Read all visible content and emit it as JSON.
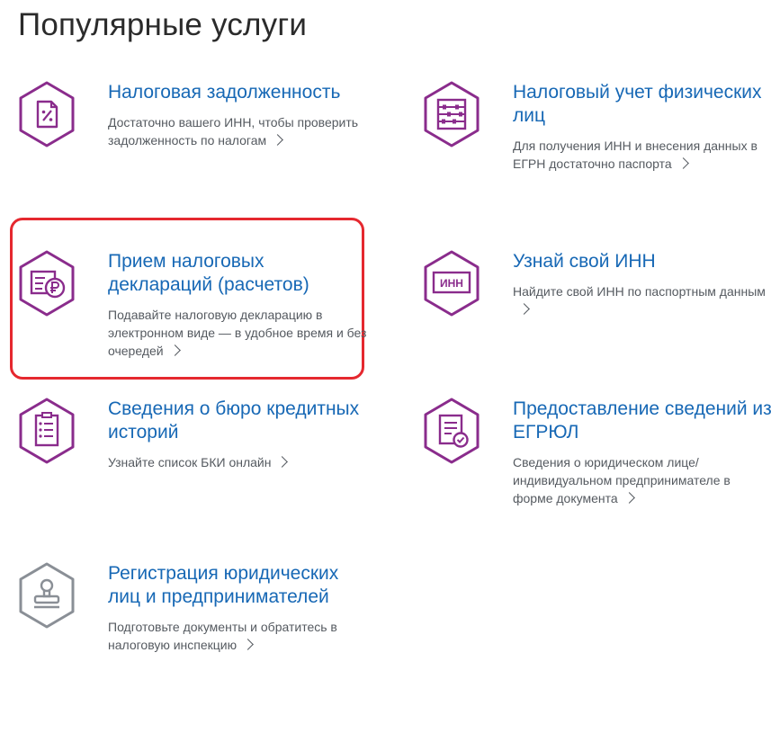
{
  "page": {
    "title": "Популярные услуги"
  },
  "colors": {
    "title": "#1768b5",
    "text": "#555a60",
    "icon_primary": "#8a2c8c",
    "icon_secondary": "#8a8f96",
    "highlight": "#e5282f"
  },
  "services": [
    {
      "title": "Налоговая задолженность",
      "description": "Достаточно вашего ИНН, чтобы проверить задолженность по налогам",
      "icon": "tax-debt-document-icon"
    },
    {
      "title": "Налоговый учет физических лиц",
      "description": "Для получения ИНН и внесения данных в ЕГРН достаточно паспорта",
      "icon": "abacus-icon"
    },
    {
      "title": "Прием налоговых деклараций (расчетов)",
      "description": "Подавайте налоговую декларацию в электронном виде — в удобное время и без очередей",
      "icon": "declaration-ruble-icon",
      "highlighted": true
    },
    {
      "title": "Узнай свой ИНН",
      "description": "Найдите свой ИНН по паспортным данным",
      "icon": "inn-card-icon",
      "icon_text": "ИНН"
    },
    {
      "title": "Сведения о бюро кредитных историй",
      "description": "Узнайте список БКИ онлайн",
      "icon": "checklist-icon"
    },
    {
      "title": "Предоставление сведений из ЕГРЮЛ",
      "description": "Сведения о юридическом лице/индивидуальном предпринимателе в форме документа",
      "icon": "document-check-icon"
    },
    {
      "title": "Регистрация юридических лиц и предпринимателей",
      "description": "Подготовьте документы и обратитесь в налоговую инспекцию",
      "icon": "stamp-icon"
    }
  ]
}
